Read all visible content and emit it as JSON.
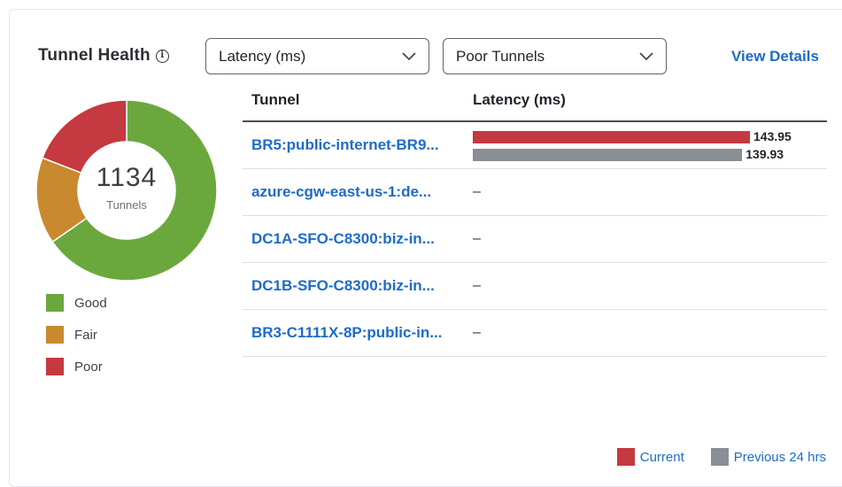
{
  "widget": {
    "title": "Tunnel Health",
    "info_icon": "info-icon",
    "view_details": "View Details"
  },
  "filters": {
    "metric": {
      "selected": "Latency (ms)"
    },
    "scope": {
      "selected": "Poor Tunnels"
    }
  },
  "summary": {
    "total": "1134",
    "total_label": "Tunnels",
    "segments": [
      {
        "label": "Good",
        "value": 741,
        "color": "#6aa83e"
      },
      {
        "label": "Fair",
        "value": 176,
        "color": "#c9892f"
      },
      {
        "label": "Poor",
        "value": 217,
        "color": "#c53940"
      }
    ]
  },
  "table": {
    "columns": [
      "Tunnel",
      "Latency (ms)"
    ],
    "rows": [
      {
        "tunnel": "BR5:public-internet-BR9...",
        "current": "143.95",
        "previous": "139.93"
      },
      {
        "tunnel": "azure-cgw-east-us-1:de...",
        "value": "–"
      },
      {
        "tunnel": "DC1A-SFO-C8300:biz-in...",
        "value": "–"
      },
      {
        "tunnel": "DC1B-SFO-C8300:biz-in...",
        "value": "–"
      },
      {
        "tunnel": "BR3-C1111X-8P:public-in...",
        "value": "–"
      }
    ],
    "bar_max": 143.95
  },
  "bar_legend": {
    "current": {
      "label": "Current",
      "color": "#c53940"
    },
    "previous": {
      "label": "Previous 24 hrs",
      "color": "#8a8f95"
    }
  }
}
